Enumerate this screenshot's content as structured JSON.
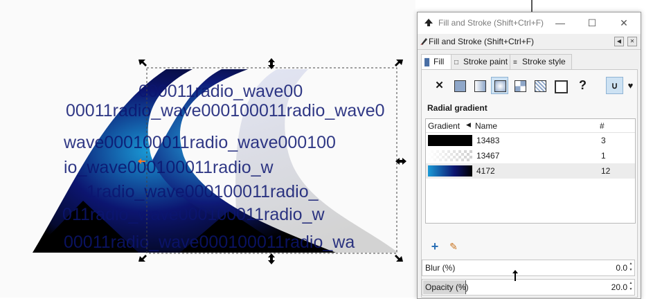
{
  "canvas": {
    "watermark_lines": [
      "000011radio_wave00",
      "00011radio_wave000100011radio_wave0",
      "wave000100011radio_wave000100",
      "io_wave000100011radio_w",
      "1radio_wave000100011radio_",
      "011radio_wave000100011radio_w",
      "00011radio_wave000100011radio_wa"
    ],
    "colors": {
      "dark_blue": "#0c1570",
      "mid_blue": "#1a9ad6",
      "black": "#000000",
      "pale": "#dde1f1"
    }
  },
  "dialog": {
    "window_title": "Fill and Stroke (Shift+Ctrl+F)",
    "panel_title": "Fill and Stroke (Shift+Ctrl+F)",
    "icons": [
      "inkscape-app-icon",
      "minimize-icon",
      "maximize-icon",
      "close-icon",
      "dock-icon",
      "panel-close-icon"
    ],
    "tabs": [
      {
        "label": "Fill",
        "icon": "fill-tab-icon",
        "active": true
      },
      {
        "label": "Stroke paint",
        "icon": "stroke-paint-tab-icon",
        "active": false
      },
      {
        "label": "Stroke style",
        "icon": "stroke-style-tab-icon",
        "active": false
      }
    ],
    "paint_types": [
      "no-paint-icon",
      "flat-color-icon",
      "linear-gradient-icon",
      "radial-gradient-icon",
      "pattern-icon",
      "swatch-icon",
      "mesh-icon",
      "unset-paint-icon",
      "fill-rule-evenodd-icon",
      "fill-rule-nonzero-icon"
    ],
    "section_title": "Radial gradient",
    "gradient_list": {
      "headers": {
        "gradient": "Gradient",
        "name": "Name",
        "count": "#"
      },
      "rows": [
        {
          "name": "13483",
          "count": "3",
          "selected": false
        },
        {
          "name": "13467",
          "count": "1",
          "selected": false
        },
        {
          "name": "4172",
          "count": "12",
          "selected": true
        }
      ]
    },
    "list_buttons": [
      "add-gradient-icon",
      "edit-gradient-icon"
    ],
    "blur": {
      "label": "Blur (%)",
      "value": "0.0"
    },
    "opacity": {
      "label": "Opacity (%)",
      "value": "20.0",
      "fill_fraction": 0.2
    }
  }
}
